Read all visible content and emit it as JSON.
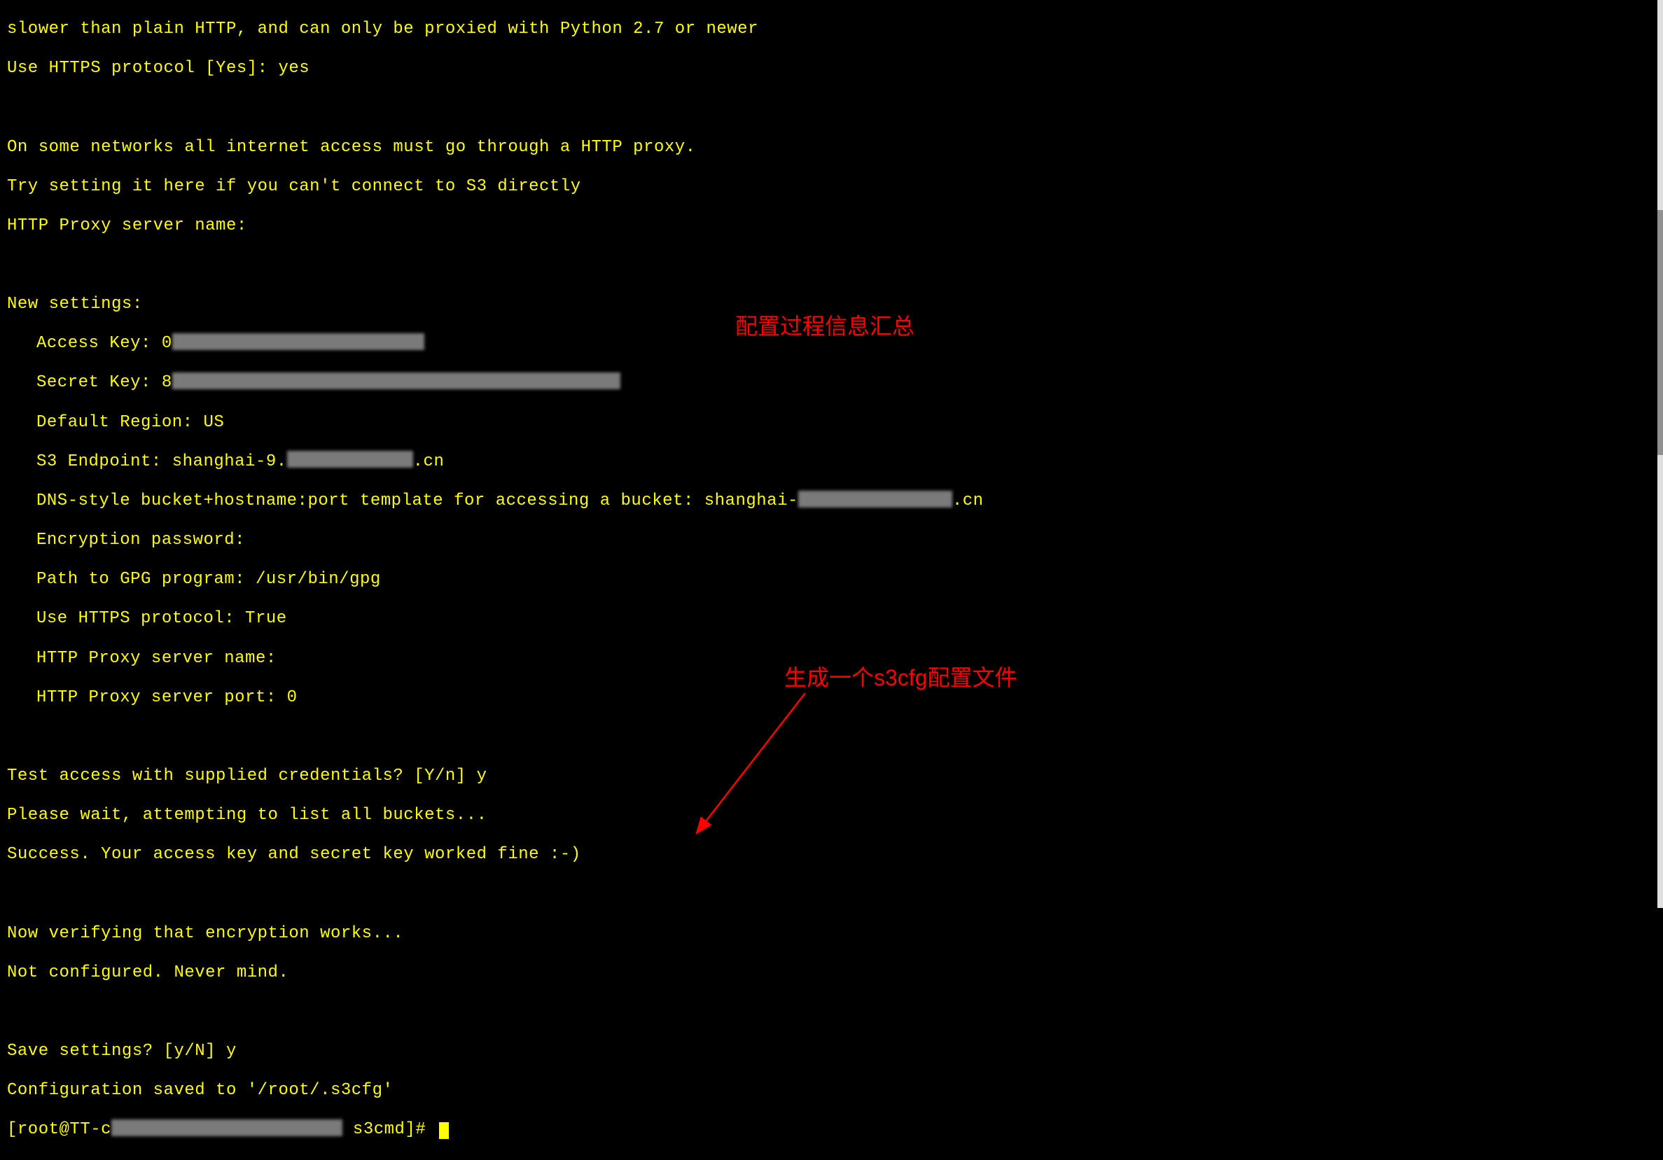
{
  "terminal": {
    "line_partial_top": "slower than plain HTTP, and can only be proxied with Python 2.7 or newer",
    "line_https_prompt": "Use HTTPS protocol [Yes]: yes",
    "line_proxy_info1": "On some networks all internet access must go through a HTTP proxy.",
    "line_proxy_info2": "Try setting it here if you can't connect to S3 directly",
    "line_proxy_prompt": "HTTP Proxy server name:",
    "line_new_settings": "New settings:",
    "line_access_key_label": "Access Key: 0",
    "line_secret_key_label": "Secret Key: 8",
    "line_default_region": "Default Region: US",
    "line_s3_endpoint_label": "S3 Endpoint: shanghai-9.",
    "line_s3_endpoint_suffix": ".cn",
    "line_dns_template_label": "DNS-style bucket+hostname:port template for accessing a bucket: shanghai-",
    "line_dns_template_suffix": ".cn",
    "line_enc_password": "Encryption password:",
    "line_gpg_path": "Path to GPG program: /usr/bin/gpg",
    "line_use_https": "Use HTTPS protocol: True",
    "line_proxy_name": "HTTP Proxy server name:",
    "line_proxy_port": "HTTP Proxy server port: 0",
    "line_test_access": "Test access with supplied credentials? [Y/n] y",
    "line_please_wait": "Please wait, attempting to list all buckets...",
    "line_success": "Success. Your access key and secret key worked fine :-)",
    "line_verify_enc": "Now verifying that encryption works...",
    "line_not_configured": "Not configured. Never mind.",
    "line_save_settings": "Save settings? [y/N] y",
    "line_config_saved": "Configuration saved to '/root/.s3cfg'",
    "line_prompt_user": "[root@TT-c",
    "line_prompt_cmd": " s3cmd]# "
  },
  "annotations": {
    "summary_label": "配置过程信息汇总",
    "cfg_file_label": "生成一个s3cfg配置文件"
  }
}
